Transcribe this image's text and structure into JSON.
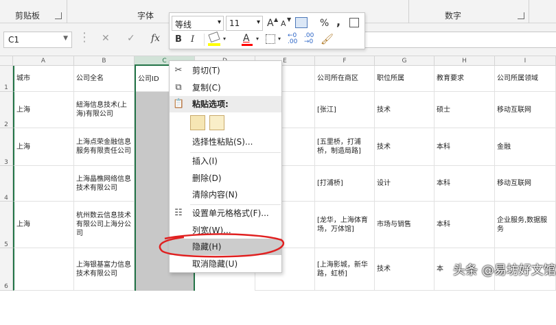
{
  "ribbon": {
    "groups": [
      "剪贴板",
      "字体",
      "数字"
    ]
  },
  "formula_bar": {
    "name_box": "C1",
    "cancel_icon": "close-icon",
    "confirm_icon": "check-icon",
    "fx_label": "fx",
    "value": ""
  },
  "columns": [
    "A",
    "B",
    "C",
    "D",
    "E",
    "F",
    "G",
    "H",
    "I"
  ],
  "rows": [
    "1",
    "2",
    "3",
    "4",
    "5",
    "6"
  ],
  "table": {
    "A": [
      "城市",
      "上海",
      "上海",
      "",
      "上海",
      ""
    ],
    "B": [
      "公司全名",
      "紐海信息技术(上海)有限公司",
      "上海点荣金融信息服务有限责任公司",
      "上海晶樵网络信息技术有限公司",
      "杭州数云信息技术有限公司上海分公司",
      "上海银基富力信息技术有限公司"
    ],
    "C": [
      "公司ID",
      "",
      "",
      "",
      "",
      ""
    ],
    "D": [
      "",
      "",
      "",
      "",
      "",
      ""
    ],
    "E": [
      "n",
      "上",
      "0人",
      "",
      "人",
      ""
    ],
    "F": [
      "公司所在商区",
      "[张江]",
      "[五里桥，打浦桥，制造局路]",
      "[打浦桥]",
      "[龙华，上海体育场，万体馆]",
      "[上海影城，新华路，虹桥]"
    ],
    "G": [
      "职位所属",
      "技术",
      "技术",
      "设计",
      "市场与销售",
      "技术"
    ],
    "H": [
      "教育要求",
      "硕士",
      "本科",
      "本科",
      "本科",
      "本"
    ],
    "I": [
      "公司所属领域",
      "移动互联网",
      "金融",
      "移动互联网",
      "企业服务,数据服务",
      ""
    ]
  },
  "mini_toolbar": {
    "font_name": "等线",
    "font_size": "11",
    "grow_font": "A",
    "shrink_font": "A",
    "percent": "%",
    "comma": ",",
    "bold": "B",
    "italic": "I",
    "font_color_letter": "A",
    "colors": {
      "fill": "#ffff00",
      "font": "#ff0000"
    }
  },
  "context_menu": {
    "items": [
      {
        "label": "剪切(T)",
        "icon": "scissors-icon"
      },
      {
        "label": "复制(C)",
        "icon": "copy-icon"
      },
      {
        "label": "粘贴选项:",
        "icon": "paste-icon"
      },
      {
        "label": "选择性粘贴(S)...",
        "icon": ""
      },
      {
        "label": "插入(I)",
        "icon": ""
      },
      {
        "label": "删除(D)",
        "icon": ""
      },
      {
        "label": "清除内容(N)",
        "icon": ""
      },
      {
        "label": "设置单元格格式(F)...",
        "icon": "format-cells-icon"
      },
      {
        "label": "列宽(W)...",
        "icon": ""
      },
      {
        "label": "隐藏(H)",
        "icon": ""
      },
      {
        "label": "取消隐藏(U)",
        "icon": ""
      }
    ]
  },
  "watermark": "头条 @易坊好文馆"
}
